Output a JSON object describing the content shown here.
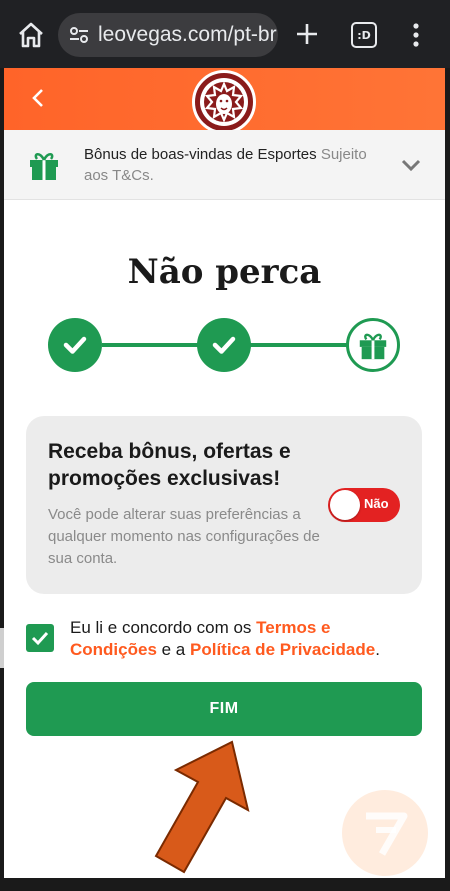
{
  "browser": {
    "url": "leovegas.com/pt-br",
    "tabs_label": ":D"
  },
  "header": {
    "logo_icon": "leovegas-lion-logo"
  },
  "bonus_banner": {
    "title": "Bônus de boas-vindas de Esportes",
    "subject_text": " Sujeito aos T&Cs."
  },
  "main": {
    "title": "Não perca",
    "steps": [
      {
        "state": "done",
        "icon": "check-icon"
      },
      {
        "state": "done",
        "icon": "check-icon"
      },
      {
        "state": "current",
        "icon": "gift-icon"
      }
    ]
  },
  "preferences": {
    "heading": "Receba bônus, ofertas e promoções exclusivas!",
    "description": "Você pode alterar suas preferências a qualquer momento nas configurações de sua conta.",
    "toggle_label": "Não",
    "toggle_on": false
  },
  "terms": {
    "checked": true,
    "text_before": "Eu li e concordo com os ",
    "terms_link": "Termos e Condições",
    "text_middle": " e a ",
    "privacy_link": "Política de Privacidade",
    "text_after": "."
  },
  "finish_button": "FIM",
  "colors": {
    "brand_orange": "#ff6a2e",
    "success_green": "#1f9a52",
    "toggle_red": "#e32222",
    "link_orange": "#ff5a1f"
  }
}
